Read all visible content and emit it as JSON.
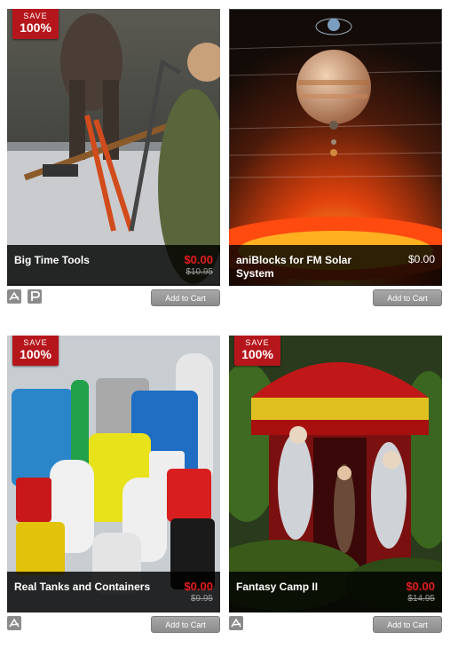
{
  "products": [
    {
      "name": "Big Time Tools",
      "save_top": "SAVE",
      "save_pct": "100%",
      "price": "$0.00",
      "original": "$10.95",
      "cart": "Add to Cart"
    },
    {
      "name": "aniBlocks for FM Solar System",
      "price": "$0.00",
      "cart": "Add to Cart"
    },
    {
      "name": "Real Tanks and Containers",
      "save_top": "SAVE",
      "save_pct": "100%",
      "price": "$0.00",
      "original": "$9.95",
      "cart": "Add to Cart"
    },
    {
      "name": "Fantasy Camp II",
      "save_top": "SAVE",
      "save_pct": "100%",
      "price": "$0.00",
      "original": "$14.95",
      "cart": "Add to Cart"
    }
  ],
  "colors": {
    "sale_badge": "#b5161b",
    "sale_price": "#e51c1c",
    "button": "#8c8c8c"
  },
  "icons": [
    "acrobat-icon",
    "poser-icon"
  ]
}
